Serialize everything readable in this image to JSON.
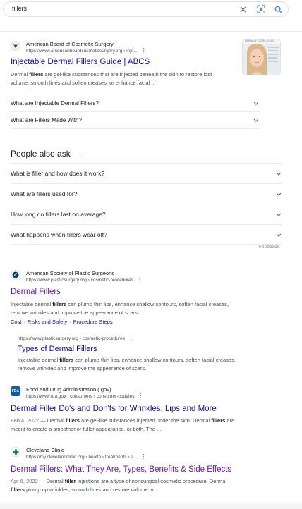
{
  "search": {
    "query": "fillers"
  },
  "colors": {
    "link": "#1a0dab",
    "visited": "#681da8",
    "snippet": "#4d5156",
    "google_blue": "#4285f4"
  },
  "results": [
    {
      "site_name": "American Board of Cosmetic Surgery",
      "url": "https://www.americanboardcosmeticsurgery.org › inje...",
      "title": "Injectable Dermal Fillers Guide | ABCS",
      "snippet": {
        "line1_a": "Dermal ",
        "line1_b": "fillers",
        "line1_c": " are gel-like substances that are injected beneath the skin to restore lost",
        "line2": "volume, smooth lines and soften creases, or enhance facial ..."
      },
      "thumbnail_banner": "DERMAL FILLERS GUIDE",
      "accordion": [
        {
          "label": "What are Injectable Dermal Fillers?"
        },
        {
          "label": "What are Fillers Made With?"
        }
      ]
    },
    {
      "site_name": "American Society of Plastic Surgeons",
      "url": "https://www.plasticsurgery.org › cosmetic-procedures",
      "title": "Dermal Fillers",
      "snippet": {
        "line1_a": "Injectable dermal ",
        "line1_b": "fillers",
        "line1_c": " can plump thin lips, enhance shallow contours, soften facial creases,",
        "line2": "remove wrinkles and improve the appearance of scars."
      },
      "sitelinks": [
        "Cost",
        "Risks and Safety",
        "Procedure Steps"
      ],
      "sub": {
        "url": "https://www.plasticsurgery.org › cosmetic-procedures",
        "title": "Types of Dermal Fillers",
        "line1_a": "Injectable dermal ",
        "line1_b": "fillers",
        "line1_c": " can plump thin lips, enhance shallow contours, soften facial creases,",
        "line2": "remove wrinkles and improve the appearance of scars."
      }
    },
    {
      "site_name": "Food and Drug Administration (.gov)",
      "url": "https://www.fda.gov › consumers › consumer-updates",
      "title": "Dermal Filler Do's and Don'ts for Wrinkles, Lips and More",
      "snippet": {
        "date": "Feb 4, 2022",
        "line1_a": " — Dermal ",
        "line1_b": "fillers",
        "line1_c": " are gel-like substances injected under the skin. Dermal ",
        "line1_d": "fillers",
        "line1_e": " are",
        "line2": "meant to create a smoother or fuller appearance, or both. The ..."
      }
    },
    {
      "site_name": "Cleveland Clinic",
      "url": "https://my.clevelandclinic.org › health › treatments › 2...",
      "title": "Dermal Fillers: What They Are, Types, Benefits & Side Effects",
      "snippet": {
        "date": "Apr 6, 2022",
        "line1_a": " — Dermal ",
        "line1_b": "filler",
        "line1_c": " injections are a type of nonsurgical cosmetic procedure. Dermal",
        "line2_a": "fillers",
        "line2_b": " plump up wrinkles, smooth lines and restore volume in ..."
      }
    }
  ],
  "people_also_ask": {
    "heading": "People also ask",
    "questions": [
      "What is filler and how does it work?",
      "What are fillers used for?",
      "How long do fillers last on average?",
      "What happens when fillers wear off?"
    ],
    "feedback": "Feedback"
  }
}
